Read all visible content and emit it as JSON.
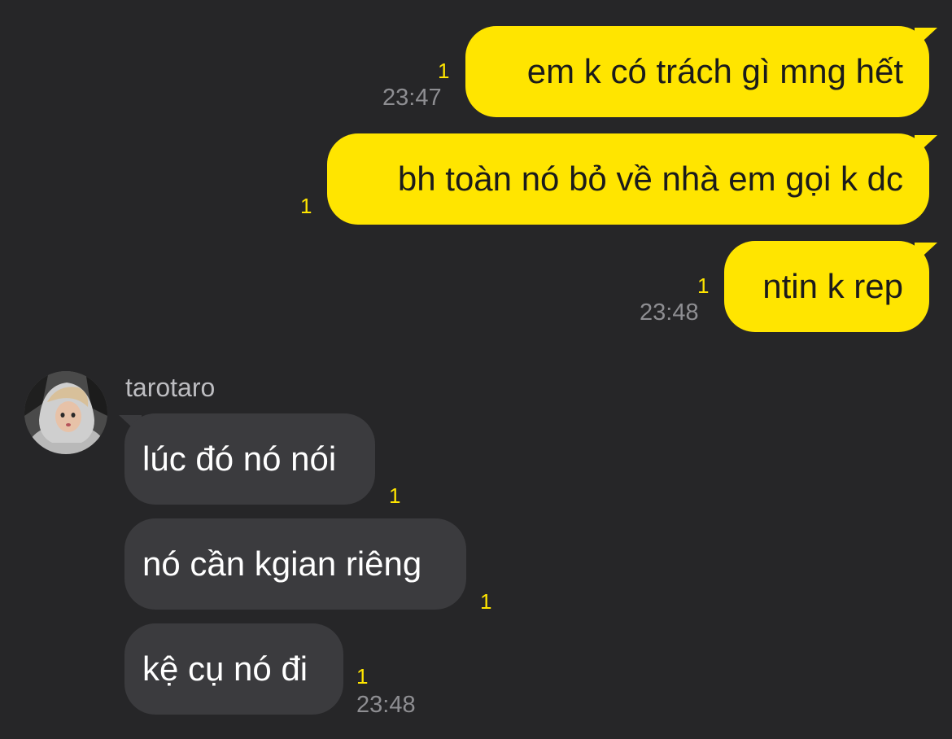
{
  "colors": {
    "background": "#262628",
    "outgoing_bubble": "#FFE500",
    "incoming_bubble": "#3b3b3e",
    "unread_indicator": "#FFE500",
    "timestamp": "#8e8e92"
  },
  "outgoing": [
    {
      "text": "em k có trách gì mng hết",
      "unread": "1",
      "time": "23:47"
    },
    {
      "text": "bh toàn nó bỏ về nhà em gọi k dc",
      "unread": "1",
      "time": ""
    },
    {
      "text": "ntin k rep",
      "unread": "1",
      "time": "23:48"
    }
  ],
  "incoming": {
    "sender": "tarotaro",
    "avatar_icon": "profile-photo",
    "messages": [
      {
        "text": "lúc đó nó nói",
        "unread": "1",
        "time": ""
      },
      {
        "text": "nó cần kgian riêng",
        "unread": "1",
        "time": ""
      },
      {
        "text": "kệ cụ nó đi",
        "unread": "1",
        "time": "23:48"
      }
    ]
  }
}
